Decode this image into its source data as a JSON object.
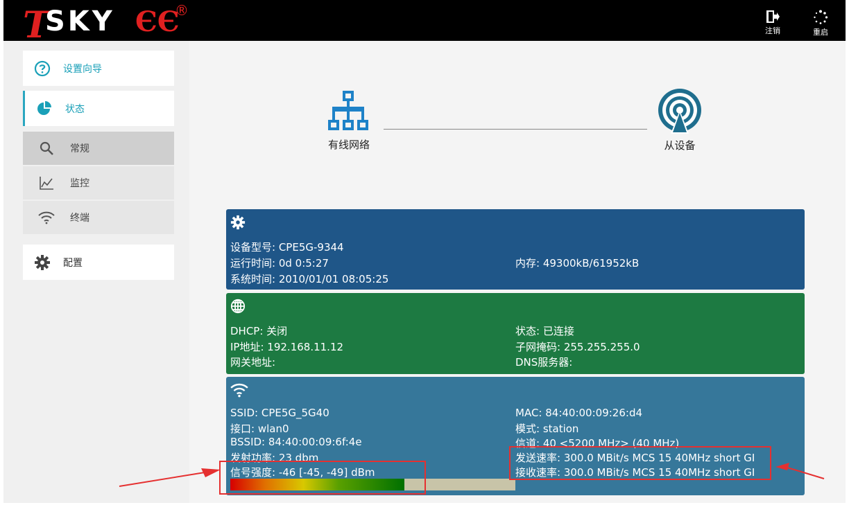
{
  "brand": {
    "logo_t": "T",
    "logo_text": "SKY",
    "logo_ee": "ЄЄ",
    "logo_reg": "®"
  },
  "topbar": {
    "logout_label": "注销",
    "reboot_label": "重启"
  },
  "sidebar": {
    "items": [
      {
        "label": "设置向导",
        "icon": "question-circle-icon"
      },
      {
        "label": "状态",
        "icon": "pie-chart-icon"
      },
      {
        "label": "常规",
        "icon": "search-icon"
      },
      {
        "label": "监控",
        "icon": "line-chart-icon"
      },
      {
        "label": "终端",
        "icon": "wifi-icon"
      },
      {
        "label": "配置",
        "icon": "gear-icon"
      }
    ]
  },
  "topology": {
    "wired_label": "有线网络",
    "client_label": "从设备"
  },
  "system": {
    "model": "设备型号: CPE5G-9344",
    "uptime": "运行时间: 0d 0:5:27",
    "systime": "系统时间: 2010/01/01 08:05:25",
    "memory": "内存: 49300kB/61952kB"
  },
  "network": {
    "dhcp": "DHCP: 关闭",
    "ip": "IP地址: 192.168.11.12",
    "gateway": "网关地址:",
    "status": "状态: 已连接",
    "netmask": "子网掩码: 255.255.255.0",
    "dns": "DNS服务器:"
  },
  "wireless": {
    "ssid": "SSID: CPE5G_5G40",
    "iface": "接口: wlan0",
    "bssid": "BSSID: 84:40:00:09:6f:4e",
    "txpower": "发射功率: 23 dbm",
    "signal": "信号强度: -46 [-45, -49] dBm",
    "mac": "MAC: 84:40:00:09:26:d4",
    "mode": "模式: station",
    "channel": "信道: 40 <5200 MHz> (40 MHz)",
    "tx_rate": "发送速率: 300.0 MBit/s MCS 15 40MHz short GI",
    "rx_rate": "接收速率: 300.0 MBit/s MCS 15 40MHz short GI",
    "signal_level": 0.61
  },
  "colors": {
    "accent": "#1aa0b8",
    "system_panel": "#1f5688",
    "network_panel": "#1d7a42",
    "wireless_panel": "#36779a",
    "highlight": "#e53030"
  }
}
